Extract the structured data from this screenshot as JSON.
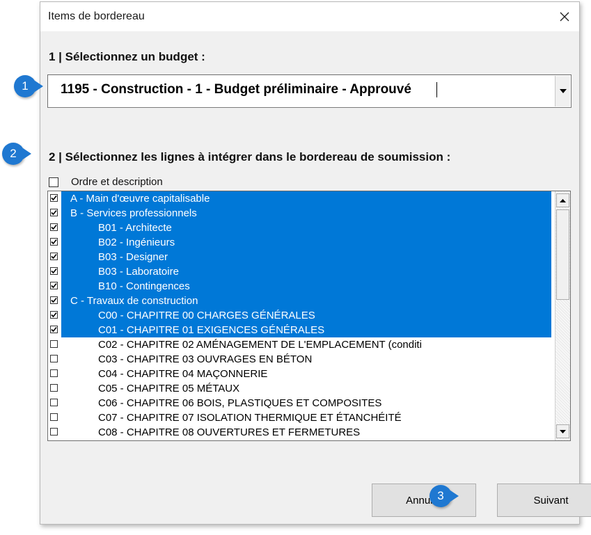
{
  "window": {
    "title": "Items de bordereau"
  },
  "step1": {
    "label": "1 | Sélectionnez un budget :",
    "selected_budget": "1195 - Construction - 1 - Budget préliminaire - Approuvé"
  },
  "step2": {
    "label": "2 | Sélectionnez les lignes à intégrer dans le bordereau de soumission :",
    "order_checkbox_label": "Ordre et description",
    "order_checked": false
  },
  "items": [
    {
      "text": "A - Main d'œuvre capitalisable",
      "checked": true,
      "indent": 0
    },
    {
      "text": "B - Services professionnels",
      "checked": true,
      "indent": 0
    },
    {
      "text": "B01 - Architecte",
      "checked": true,
      "indent": 1
    },
    {
      "text": "B02 - Ingénieurs",
      "checked": true,
      "indent": 1
    },
    {
      "text": "B03 - Designer",
      "checked": true,
      "indent": 1
    },
    {
      "text": "B03 - Laboratoire",
      "checked": true,
      "indent": 1
    },
    {
      "text": "B10 - Contingences",
      "checked": true,
      "indent": 1
    },
    {
      "text": "C - Travaux de construction",
      "checked": true,
      "indent": 0
    },
    {
      "text": "C00 - CHAPITRE 00 CHARGES GÉNÉRALES",
      "checked": true,
      "indent": 1
    },
    {
      "text": "C01 - CHAPITRE 01  EXIGENCES GÉNÉRALES",
      "checked": true,
      "indent": 1
    },
    {
      "text": "C02 - CHAPITRE 02 AMÉNAGEMENT DE L'EMPLACEMENT (conditi",
      "checked": false,
      "indent": 1
    },
    {
      "text": "C03 - CHAPITRE 03  OUVRAGES EN BÉTON",
      "checked": false,
      "indent": 1
    },
    {
      "text": "C04 - CHAPITRE 04 MAÇONNERIE",
      "checked": false,
      "indent": 1
    },
    {
      "text": "C05 - CHAPITRE 05  MÉTAUX",
      "checked": false,
      "indent": 1
    },
    {
      "text": "C06 - CHAPITRE 06  BOIS, PLASTIQUES ET COMPOSITES",
      "checked": false,
      "indent": 1
    },
    {
      "text": "C07 - CHAPITRE 07  ISOLATION THERMIQUE ET ÉTANCHÉITÉ",
      "checked": false,
      "indent": 1
    },
    {
      "text": "C08 - CHAPITRE 08  OUVERTURES ET FERMETURES",
      "checked": false,
      "indent": 1
    }
  ],
  "buttons": {
    "cancel": "Annuler",
    "next": "Suivant"
  },
  "markers": [
    "1",
    "2",
    "3"
  ],
  "colors": {
    "selection": "#0078d7",
    "marker": "#1f78d1",
    "dialog_bg": "#f0f0f0"
  },
  "icons": {
    "close": "close-icon",
    "dropdown": "chevron-down-icon",
    "scroll_up": "arrow-up-icon",
    "scroll_down": "arrow-down-icon",
    "check": "check-icon"
  }
}
